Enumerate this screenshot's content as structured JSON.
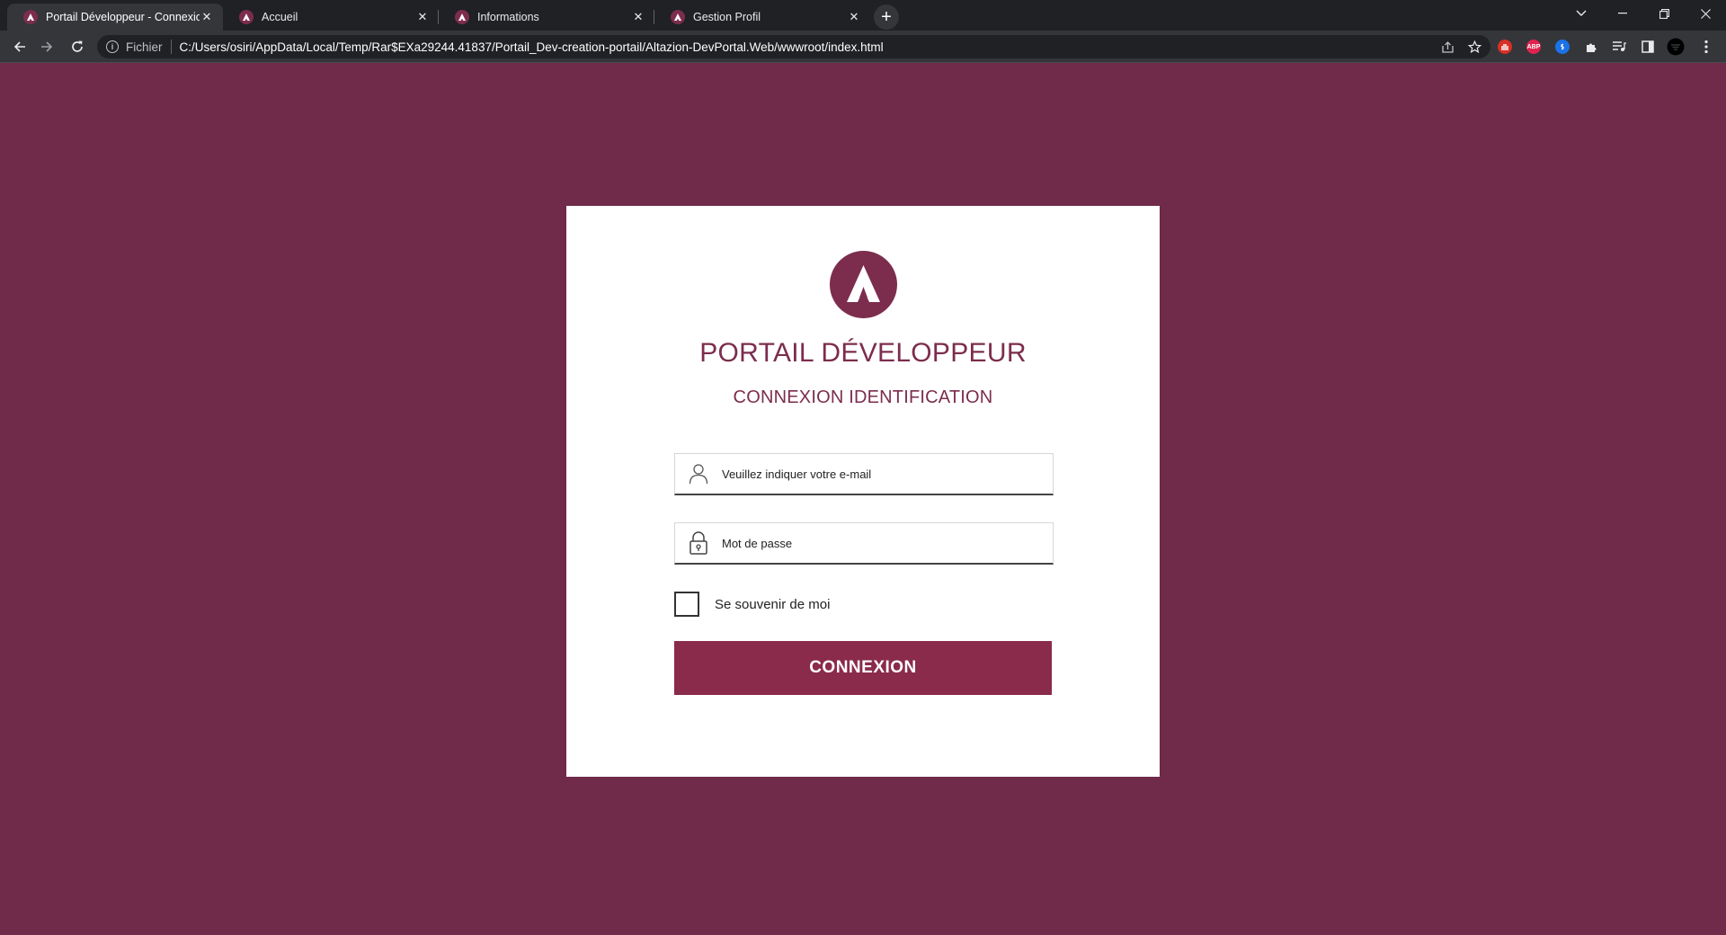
{
  "browser": {
    "tabs": [
      {
        "title": "Portail Développeur - Connexion",
        "active": true
      },
      {
        "title": "Accueil",
        "active": false
      },
      {
        "title": "Informations",
        "active": false
      },
      {
        "title": "Gestion Profil",
        "active": false
      }
    ],
    "address": {
      "scheme_label": "Fichier",
      "url": "C:/Users/osiri/AppData/Local/Temp/Rar$EXa29244.41837/Portail_Dev-creation-portail/Altazion-DevPortal.Web/wwwroot/index.html"
    },
    "extensions": [
      {
        "name": "red-hand-extension",
        "color": "#d93025",
        "label": ""
      },
      {
        "name": "adblock-plus-extension",
        "color": "#e0234e",
        "label": "ABP"
      },
      {
        "name": "shazam-extension",
        "color": "#1a73e8",
        "label": ""
      }
    ]
  },
  "login": {
    "title": "PORTAIL DÉVELOPPEUR",
    "subtitle": "CONNEXION IDENTIFICATION",
    "email_placeholder": "Veuillez indiquer votre e-mail",
    "password_placeholder": "Mot de passe",
    "remember_label": "Se souvenir de moi",
    "remember_checked": false,
    "submit_label": "CONNEXION"
  },
  "colors": {
    "page_background": "#6f2b49",
    "brand": "#7c2d4d",
    "button": "#8a2b4b"
  }
}
